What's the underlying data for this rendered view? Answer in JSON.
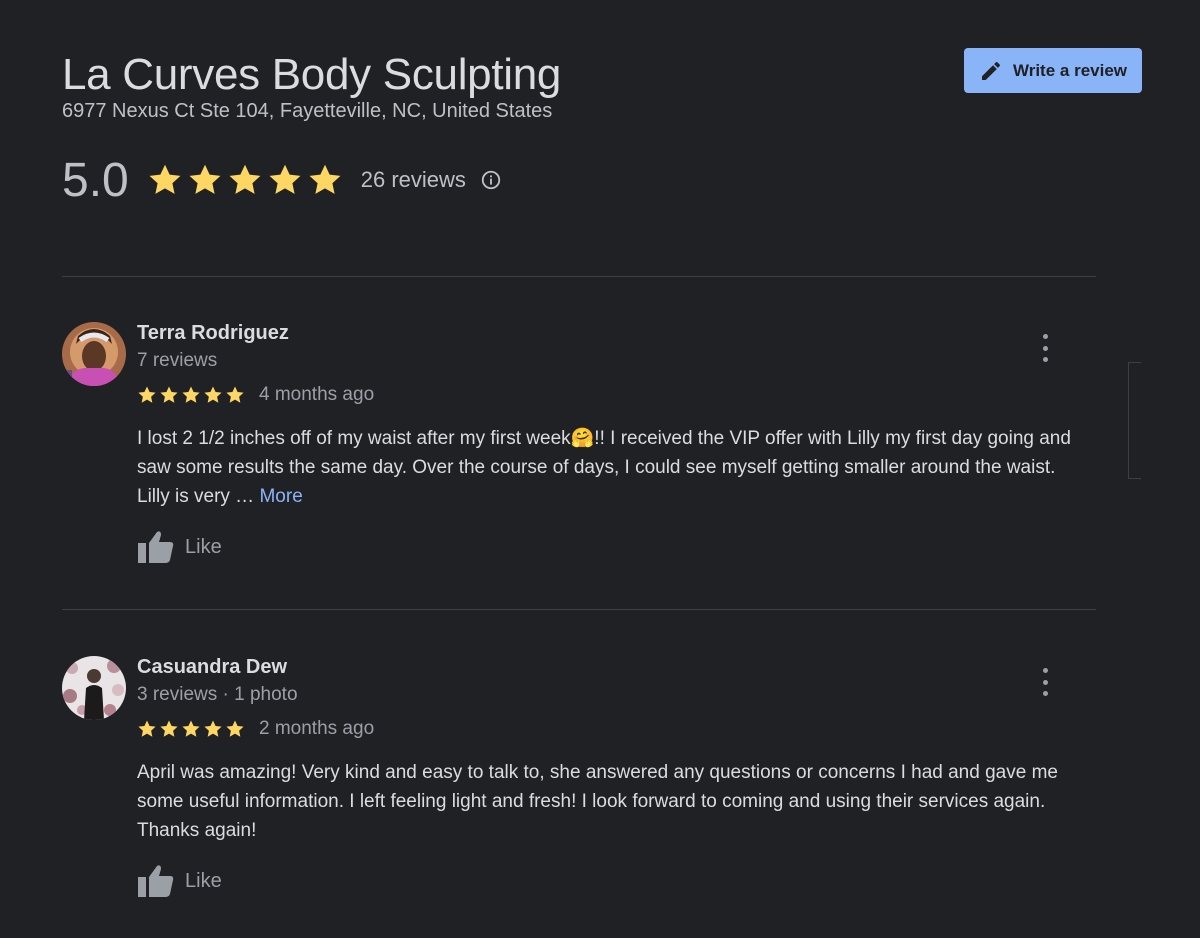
{
  "business": {
    "name": "La Curves Body Sculpting",
    "address": "6977 Nexus Ct Ste 104, Fayetteville, NC, United States",
    "rating": "5.0",
    "rating_value": 5,
    "review_count_label": "26 reviews"
  },
  "actions": {
    "write_review_label": "Write a review"
  },
  "reviews": [
    {
      "name": "Terra Rodriguez",
      "meta": "7 reviews",
      "stars": 5,
      "date": "4 months ago",
      "text": "I lost 2 1/2 inches off of my waist after my first week🤗!! I received the VIP offer with Lilly my first day going and saw some results the same day. Over the course of days, I could see myself getting smaller around the waist. Lilly is very … ",
      "more_label": "More",
      "like_label": "Like"
    },
    {
      "name": "Casuandra Dew",
      "meta": "3 reviews · 1 photo",
      "stars": 5,
      "date": "2 months ago",
      "text": "April was amazing! Very kind and easy to talk to, she answered any questions or concerns I had and gave me some useful information. I left feeling light and fresh! I look forward to coming and using their services again. Thanks again!",
      "like_label": "Like"
    }
  ],
  "colors": {
    "background": "#202124",
    "star": "#fdd663",
    "accent": "#8ab4f8",
    "divider": "#3c4043"
  },
  "icons": {
    "write": "pencil-icon",
    "info": "info-icon",
    "star": "star-icon",
    "menu": "more-vert-icon",
    "like": "thumbs-up-icon"
  }
}
